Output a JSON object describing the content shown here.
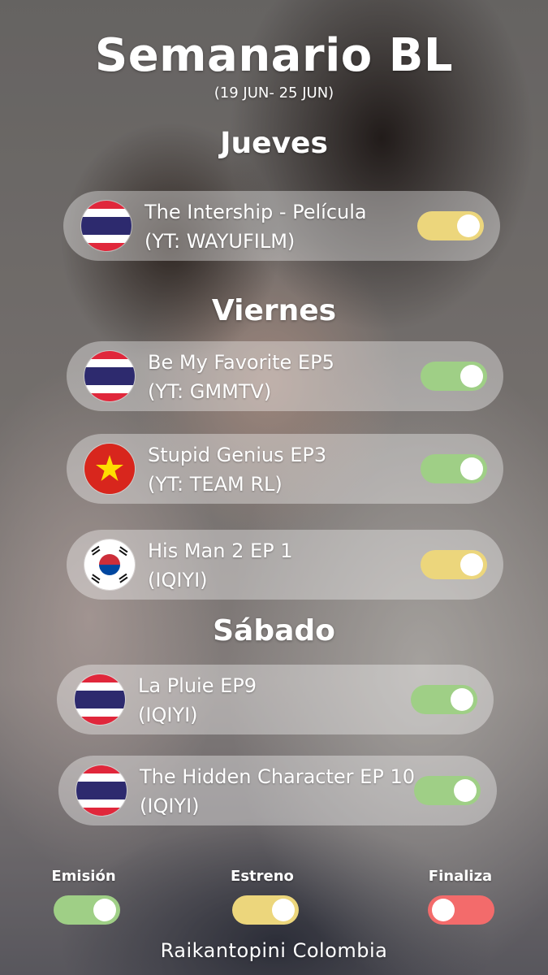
{
  "header": {
    "title": "Semanario BL",
    "subtitle": "(19 JUN- 25 JUN)"
  },
  "days": [
    {
      "name": "Jueves",
      "shows": [
        {
          "flag": "thailand-flag-icon",
          "line1": "The Intership - Película",
          "line2": "(YT: WAYUFILM)",
          "status": "Estreno"
        }
      ]
    },
    {
      "name": "Viernes",
      "shows": [
        {
          "flag": "thailand-flag-icon",
          "line1": "Be My Favorite EP5",
          "line2": "(YT: GMMTV)",
          "status": "Emisión"
        },
        {
          "flag": "vietnam-flag-icon",
          "line1": "Stupid Genius EP3",
          "line2": "(YT: TEAM RL)",
          "status": "Emisión"
        },
        {
          "flag": "south-korea-flag-icon",
          "line1": "His Man 2 EP 1",
          "line2": "(IQIYI)",
          "status": "Estreno"
        }
      ]
    },
    {
      "name": "Sábado",
      "shows": [
        {
          "flag": "thailand-flag-icon",
          "line1": "La Pluie EP9",
          "line2": "(IQIYI)",
          "status": "Emisión"
        },
        {
          "flag": "thailand-flag-icon",
          "line1": "The Hidden Character EP 10",
          "line2": "(IQIYI)",
          "status": "Emisión"
        }
      ]
    }
  ],
  "legend": [
    {
      "label": "Emisión",
      "color": "#9fcf86",
      "state": "on"
    },
    {
      "label": "Estreno",
      "color": "#ecd67c",
      "state": "on"
    },
    {
      "label": "Finaliza",
      "color": "#f36b6b",
      "state": "off"
    }
  ],
  "footer": {
    "credit": "Raikantopini Colombia"
  }
}
